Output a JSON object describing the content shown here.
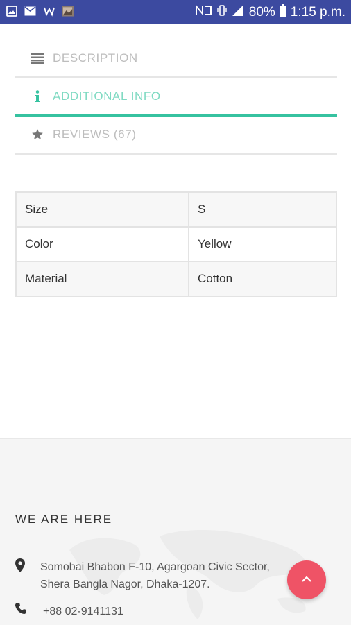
{
  "status_bar": {
    "battery": "80%",
    "time": "1:15 p.m.",
    "left_icons": [
      "image-notification-icon",
      "mail-icon",
      "app-w-icon",
      "photo-thumb-icon"
    ],
    "right_icons": [
      "nfc-icon",
      "vibrate-icon",
      "signal-icon",
      "battery-icon"
    ]
  },
  "tabs": [
    {
      "label": "DESCRIPTION",
      "icon": "list-icon",
      "active": false
    },
    {
      "label": "ADDITIONAL INFO",
      "icon": "info-icon",
      "active": true
    },
    {
      "label": "REVIEWS (67)",
      "icon": "star-icon",
      "active": false
    }
  ],
  "additional_info": [
    {
      "key": "Size",
      "value": "S"
    },
    {
      "key": "Color",
      "value": "Yellow"
    },
    {
      "key": "Material",
      "value": "Cotton"
    }
  ],
  "footer": {
    "title": "WE ARE HERE",
    "address_line1": "Somobai Bhabon F-10, Agargoan Civic Sector,",
    "address_line2": "Shera Bangla Nagor, Dhaka-1207.",
    "phone": "+88 02-9141131"
  },
  "colors": {
    "status_bar": "#3c4aa0",
    "accent": "#36c2a0",
    "fab": "#ef5366"
  }
}
